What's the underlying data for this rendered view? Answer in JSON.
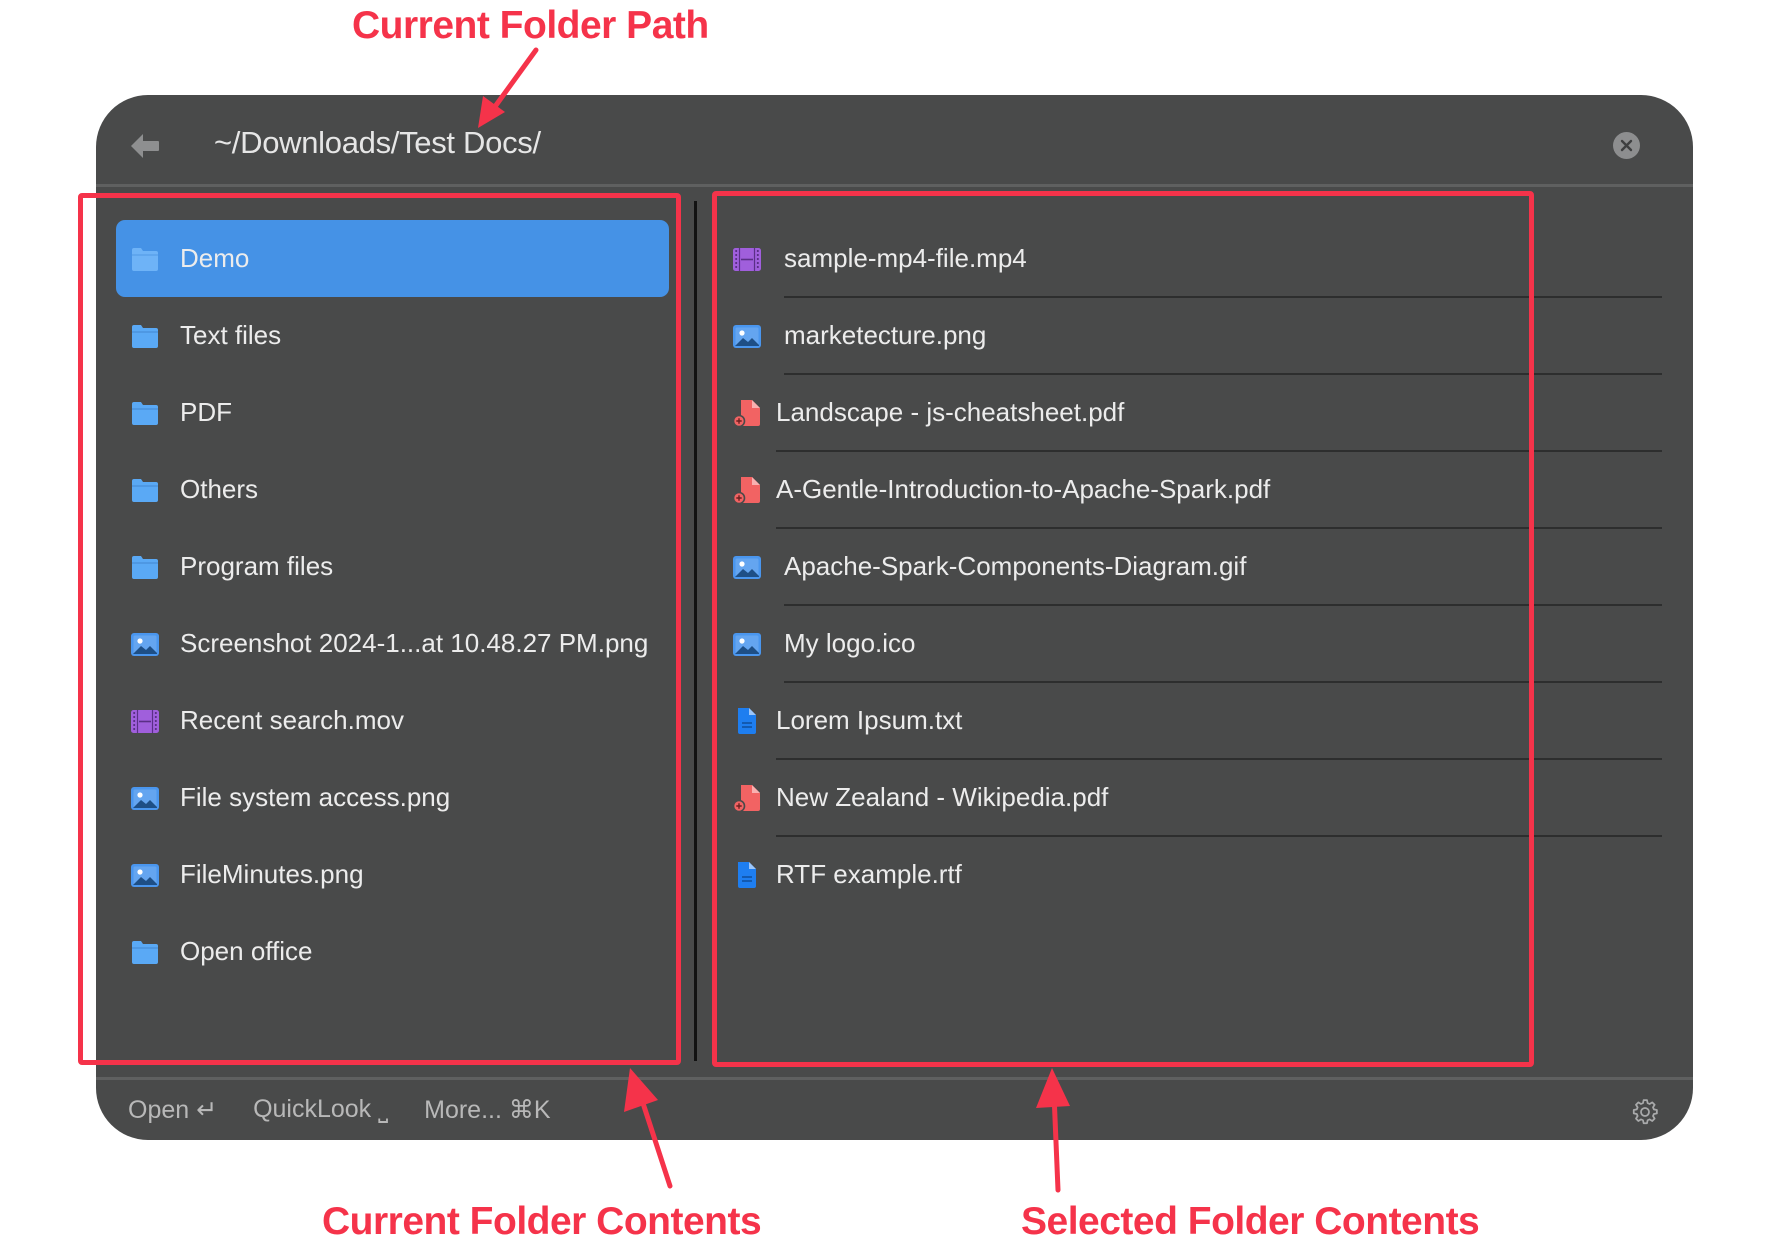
{
  "header": {
    "path": "~/Downloads/Test Docs/",
    "back_icon": "arrow-left-icon",
    "close_icon": "close-circle-icon"
  },
  "current_folder": {
    "items": [
      {
        "name": "Demo",
        "type": "folder",
        "icon": "folder-icon",
        "selected": true
      },
      {
        "name": "Text files",
        "type": "folder",
        "icon": "folder-icon"
      },
      {
        "name": "PDF",
        "type": "folder",
        "icon": "folder-icon"
      },
      {
        "name": "Others",
        "type": "folder",
        "icon": "folder-icon"
      },
      {
        "name": "Program files",
        "type": "folder",
        "icon": "folder-icon"
      },
      {
        "name": "Screenshot 2024-1...at 10.48.27 PM.png",
        "type": "image",
        "icon": "image-file-icon"
      },
      {
        "name": "Recent search.mov",
        "type": "video",
        "icon": "video-file-icon"
      },
      {
        "name": "File system access.png",
        "type": "image",
        "icon": "image-file-icon"
      },
      {
        "name": "FileMinutes.png",
        "type": "image",
        "icon": "image-file-icon"
      },
      {
        "name": "Open office",
        "type": "folder",
        "icon": "folder-icon"
      }
    ]
  },
  "selected_folder": {
    "items": [
      {
        "name": "sample-mp4-file.mp4",
        "type": "video",
        "icon": "video-file-icon"
      },
      {
        "name": "marketecture.png",
        "type": "image",
        "icon": "image-file-icon"
      },
      {
        "name": "Landscape - js-cheatsheet.pdf",
        "type": "pdf",
        "icon": "pdf-file-icon"
      },
      {
        "name": "A-Gentle-Introduction-to-Apache-Spark.pdf",
        "type": "pdf",
        "icon": "pdf-file-icon"
      },
      {
        "name": "Apache-Spark-Components-Diagram.gif",
        "type": "image",
        "icon": "image-file-icon"
      },
      {
        "name": "My logo.ico",
        "type": "image",
        "icon": "image-file-icon"
      },
      {
        "name": "Lorem Ipsum.txt",
        "type": "doc",
        "icon": "text-file-icon"
      },
      {
        "name": "New Zealand - Wikipedia.pdf",
        "type": "pdf",
        "icon": "pdf-file-icon"
      },
      {
        "name": "RTF example.rtf",
        "type": "doc",
        "icon": "text-file-icon"
      }
    ]
  },
  "footer": {
    "open_label": "Open ↵",
    "quicklook_label": "QuickLook ⎵",
    "more_label": "More... ⌘K",
    "settings_icon": "gear-icon"
  },
  "annotations": {
    "top": "Current Folder Path",
    "bottom_left": "Current Folder Contents",
    "bottom_right": "Selected Folder Contents",
    "color": "#f5334a"
  },
  "colors": {
    "panel_bg": "#494a4a",
    "selection": "#4592e6",
    "folder": "#5aa9f5",
    "image": "#4a96ee",
    "video": "#a05fdc",
    "pdf": "#f26363",
    "doc": "#1e7ef0"
  }
}
